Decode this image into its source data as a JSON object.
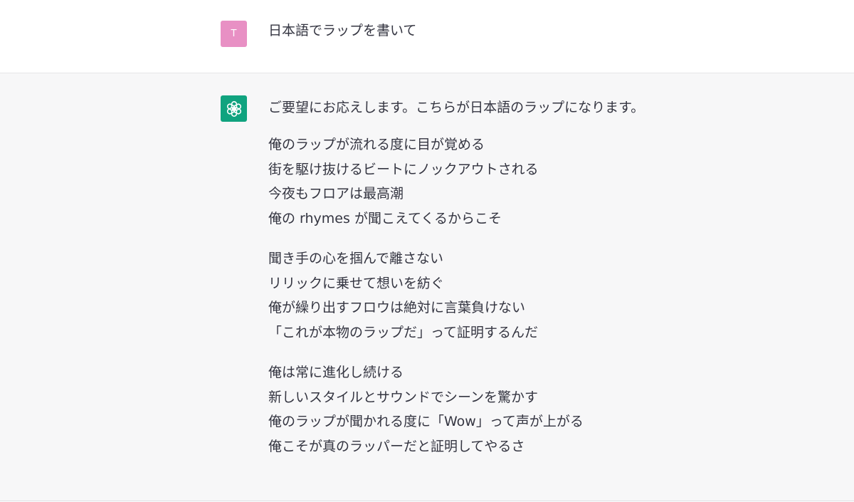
{
  "user_message": {
    "avatar_letter": "T",
    "text": "日本語でラップを書いて"
  },
  "assistant_message": {
    "avatar_icon": "openai-logo-icon",
    "intro": "ご要望にお応えします。こちらが日本語のラップになります。",
    "stanzas": [
      {
        "lines": [
          "俺のラップが流れる度に目が覚める",
          "街を駆け抜けるビートにノックアウトされる",
          "今夜もフロアは最高潮",
          "俺の rhymes が聞こえてくるからこそ"
        ]
      },
      {
        "lines": [
          "聞き手の心を掴んで離さない",
          "リリックに乗せて想いを紡ぐ",
          "俺が繰り出すフロウは絶対に言葉負けない",
          "「これが本物のラップだ」って証明するんだ"
        ]
      },
      {
        "lines": [
          "俺は常に進化し続ける",
          "新しいスタイルとサウンドでシーンを驚かす",
          "俺のラップが聞かれる度に「Wow」って声が上がる",
          "俺こそが真のラッパーだと証明してやるさ"
        ]
      }
    ]
  },
  "colors": {
    "user_avatar": "#e890c4",
    "assistant_avatar": "#10a37f",
    "assistant_background": "#f7f7f8",
    "text": "#343541"
  }
}
